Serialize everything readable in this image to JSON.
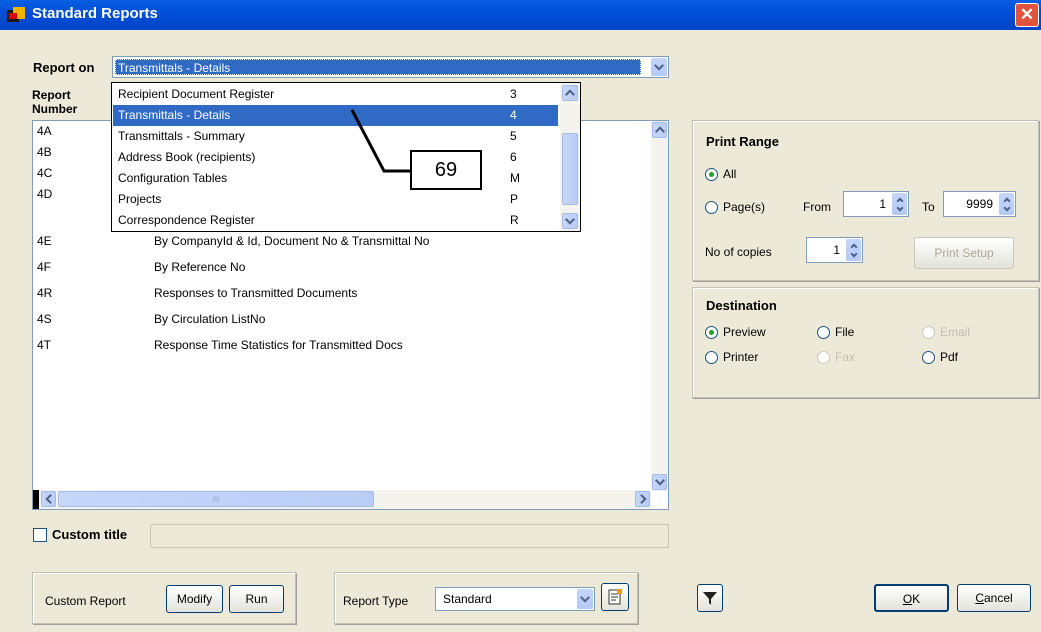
{
  "window": {
    "title": "Standard Reports",
    "close_glyph": "✕"
  },
  "report_on": {
    "label": "Report on",
    "value": "Transmittals - Details"
  },
  "report_list": {
    "header_line1": "Report",
    "header_line2": "Number",
    "rows": [
      {
        "num": "4A",
        "desc": ""
      },
      {
        "num": "4B",
        "desc": ""
      },
      {
        "num": "4C",
        "desc": ""
      },
      {
        "num": "4D",
        "desc": ""
      },
      {
        "num": "4E",
        "desc": "By CompanyId & Id, Document No & Transmittal No"
      },
      {
        "num": "4F",
        "desc": "By Reference No"
      },
      {
        "num": "4R",
        "desc": "Responses to Transmitted Documents"
      },
      {
        "num": "4S",
        "desc": "By Circulation ListNo"
      },
      {
        "num": "4T",
        "desc": "Response Time Statistics for Transmitted Docs"
      }
    ],
    "hscroll_grip": "III"
  },
  "dropdown": {
    "items": [
      {
        "label": "Recipient Document Register",
        "code": "3"
      },
      {
        "label": "Transmittals - Details",
        "code": "4"
      },
      {
        "label": "Transmittals - Summary",
        "code": "5"
      },
      {
        "label": "Address Book (recipients)",
        "code": "6"
      },
      {
        "label": "Configuration Tables",
        "code": "M"
      },
      {
        "label": "Projects",
        "code": "P"
      },
      {
        "label": "Correspondence Register",
        "code": "R"
      }
    ],
    "selected_index": 1
  },
  "callout": {
    "text": "69"
  },
  "custom_title": {
    "label": "Custom title",
    "value": "",
    "checked": false
  },
  "custom_report": {
    "label": "Custom Report",
    "modify": "Modify",
    "run": "Run"
  },
  "report_type": {
    "label": "Report Type",
    "value": "Standard"
  },
  "print_range": {
    "title": "Print Range",
    "all": "All",
    "pages": "Page(s)",
    "from_label": "From",
    "from_value": "1",
    "to_label": "To",
    "to_value": "9999",
    "copies_label": "No of copies",
    "copies_value": "1",
    "print_setup": "Print Setup"
  },
  "destination": {
    "title": "Destination",
    "preview": "Preview",
    "file": "File",
    "email": "Email",
    "printer": "Printer",
    "fax": "Fax",
    "pdf": "Pdf"
  },
  "footer": {
    "ok_hotkey": "O",
    "ok_rest": "K",
    "cancel_hotkey": "C",
    "cancel_rest": "ancel"
  },
  "colors": {
    "titlebar": "#0050d8",
    "selection": "#316ac5",
    "window_bg": "#ece9d8",
    "close": "#e1533a"
  }
}
